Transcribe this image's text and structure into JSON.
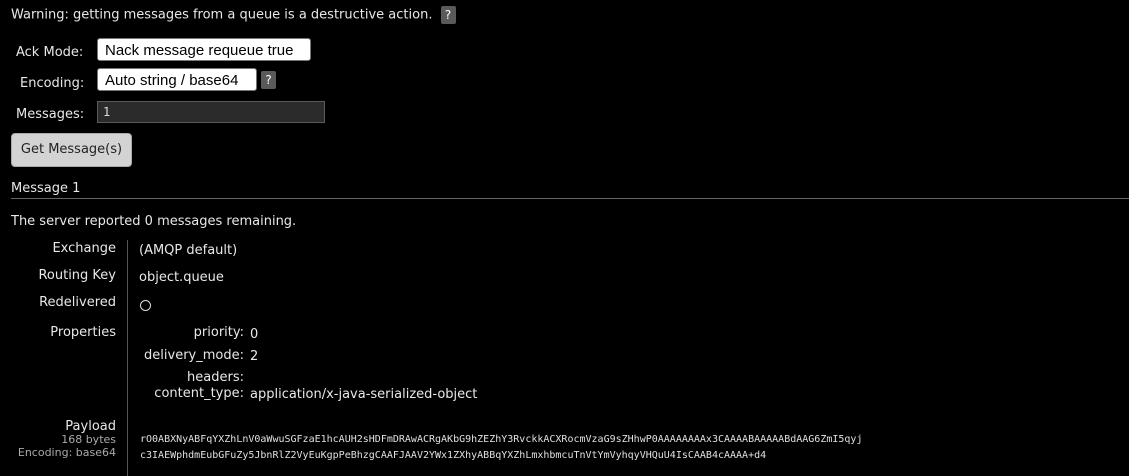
{
  "warning": {
    "text": "Warning: getting messages from a queue is a destructive action.",
    "help": "?"
  },
  "form": {
    "ack_mode_label": "Ack Mode:",
    "ack_mode_value": "Nack message requeue true",
    "encoding_label": "Encoding:",
    "encoding_value": "Auto string / base64",
    "encoding_help": "?",
    "messages_label": "Messages:",
    "messages_value": "1",
    "get_button": "Get Message(s)"
  },
  "message": {
    "heading": "Message 1",
    "remaining": "The server reported 0 messages remaining.",
    "exchange_label": "Exchange",
    "exchange_value": "(AMQP default)",
    "routing_key_label": "Routing Key",
    "routing_key_value": "object.queue",
    "redelivered_label": "Redelivered",
    "properties_label": "Properties",
    "properties": {
      "priority_label": "priority:",
      "priority_value": "0",
      "delivery_mode_label": "delivery_mode:",
      "delivery_mode_value": "2",
      "headers_label": "headers:",
      "content_type_label": "content_type:",
      "content_type_value": "application/x-java-serialized-object"
    },
    "payload_label": "Payload",
    "payload_size": "168 bytes",
    "payload_encoding": "Encoding: base64",
    "payload_line1": "rO0ABXNyABFqYXZhLnV0aWwuSGFzaE1hcAUH2sHDFmDRAwACRgAKbG9hZEZhY3RvckkACXRocmVzaG9sZHhwP0AAAAAAAAx3CAAAABAAAAABdAAG6ZmI5qyj",
    "payload_line2": "c3IAEWphdmEubGFuZy5JbnRlZ2VyEuKgpPeBhzgCAAFJAAV2YWx1ZXhyABBqYXZhLmxhbmcuTnVtYmVyhqyVHQuU4IsCAAB4cAAAA+d4"
  }
}
